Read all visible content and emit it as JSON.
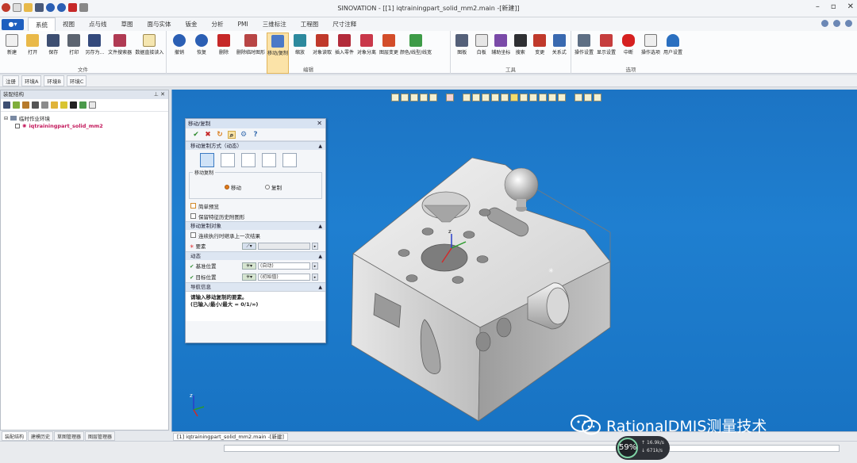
{
  "window": {
    "title": "SINOVATION - [[1] iqtrainingpart_solid_mm2.main -[新建]]"
  },
  "ribbon_tabs": [
    "系统",
    "视图",
    "点与线",
    "草图",
    "面与实体",
    "钣金",
    "分析",
    "PMI",
    "三维标注",
    "工程图",
    "尺寸注释"
  ],
  "ribbon_groups": [
    {
      "name": "文件",
      "buttons": [
        "新建",
        "打开",
        "保存",
        "打印",
        "另存为...",
        "文件搜索器",
        "数据直接读入"
      ]
    },
    {
      "name": "编辑",
      "buttons": [
        "撤销",
        "恢复",
        "删除",
        "删除临时图形",
        "移动/复制",
        "缩放",
        "对象读取",
        "插入零件",
        "对象分离",
        "图层变更",
        "颜色/线型/线宽"
      ]
    },
    {
      "name": "工具",
      "buttons": [
        "图板",
        "白板",
        "辅助坐标",
        "搜索",
        "变更",
        "关系式"
      ]
    },
    {
      "name": "选项",
      "buttons": [
        "操作设置",
        "显示设置",
        "中断",
        "操作选项",
        "用户设置"
      ]
    }
  ],
  "environments": [
    "注册",
    "环境A",
    "环境B",
    "环境C"
  ],
  "assembly_panel": {
    "title": "装配结构",
    "tree": [
      {
        "label": "临时作业环境"
      },
      {
        "label": "iqtrainingpart_solid_mm2"
      }
    ],
    "bottom_tabs": [
      "装配结构",
      "建模历史",
      "草图管理器",
      "图层管理器"
    ]
  },
  "dialog": {
    "title": "移动/复制",
    "section_mode": "移动复制方式（动态）",
    "fieldset_label": "移动复制",
    "radio_move": "移动",
    "radio_copy": "复制",
    "check_simple": "简单预览",
    "check_keep": "保留特征历史附图形",
    "section_target": "移动复制对象",
    "check_continue": "连续执行时继承上一次结果",
    "element_label": "要素",
    "section_dynamic": "动态",
    "base_label": "基准位置",
    "base_value": "(自动)",
    "target_label": "目标位置",
    "target_value": "(初始值)",
    "section_guide": "导航信息",
    "hint_line1": "请输入移动复制的要素。",
    "hint_line2": "(已输入/最小/最大 = 0/1/∞)"
  },
  "viewport": {
    "doc_tab": "[1] iqtrainingpart_solid_mm2.main -[新建]"
  },
  "performance": {
    "percent": "59%",
    "up": "16.9k/s",
    "down": "671k/s"
  },
  "watermark": "RationalDMIS测量技术",
  "colors": {
    "viewport_bg": "#1c74c4",
    "accent": "#1e5fbf",
    "tree_child": "#c3185b"
  }
}
